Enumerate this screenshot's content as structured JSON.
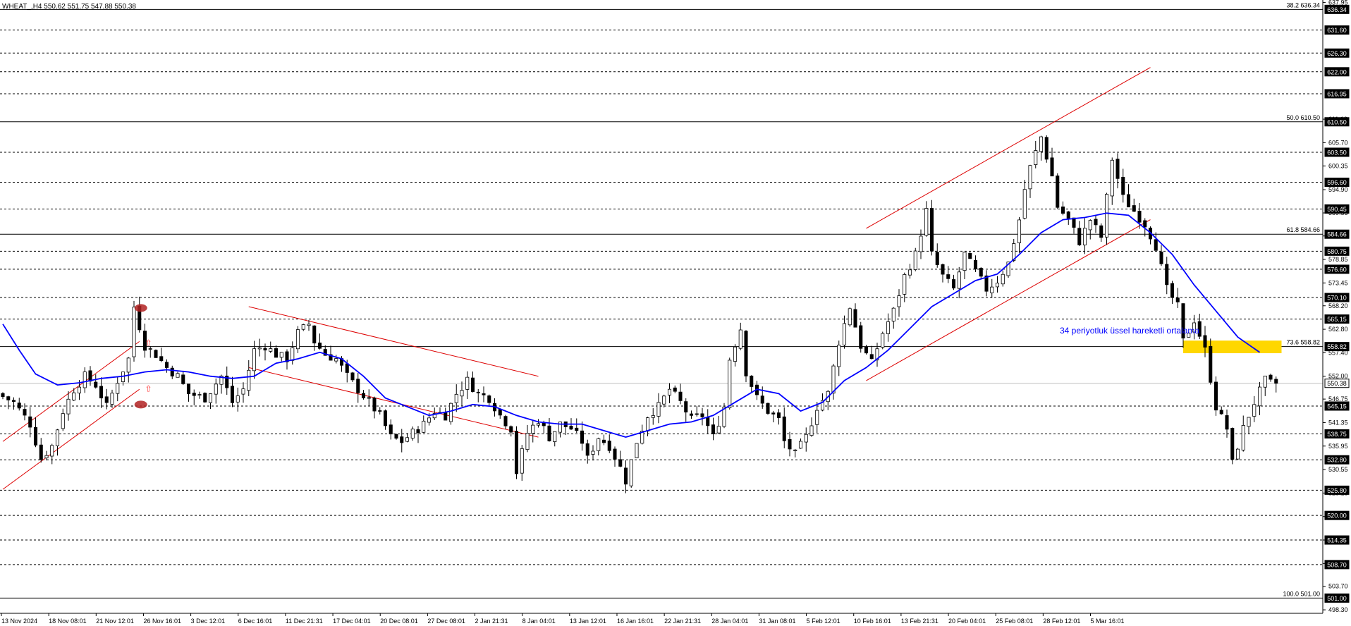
{
  "header": {
    "text": "WHEAT_,H4  550.62 551.75 547.88 550.38"
  },
  "chart_data": {
    "type": "candlestick",
    "symbol": "WHEAT_",
    "timeframe": "H4",
    "ohlc_header": {
      "open": 550.62,
      "high": 551.75,
      "low": 547.88,
      "close": 550.38
    },
    "current_price": 550.38,
    "y_range": [
      497.5,
      638.5
    ],
    "y_ticks": [
      "637.95",
      "611.10",
      "605.70",
      "600.35",
      "594.90",
      "589.55",
      "584.25",
      "578.85",
      "573.45",
      "568.20",
      "562.80",
      "557.40",
      "552.00",
      "546.75",
      "541.35",
      "535.95",
      "530.55",
      "525.15",
      "519.75",
      "514.35",
      "508.95",
      "503.70",
      "498.30"
    ],
    "price_tags": [
      "636.34",
      "631.60",
      "626.30",
      "622.00",
      "616.95",
      "610.50",
      "603.50",
      "596.60",
      "590.45",
      "584.66",
      "580.75",
      "576.60",
      "570.10",
      "565.15",
      "558.82",
      "550.38",
      "545.15",
      "538.75",
      "532.80",
      "525.80",
      "520.00",
      "514.35",
      "508.70",
      "501.00"
    ],
    "x_labels": [
      "13 Nov 2024",
      "18 Nov 08:01",
      "21 Nov 12:01",
      "26 Nov 16:01",
      "3 Dec 12:01",
      "6 Dec 16:01",
      "11 Dec 21:31",
      "17 Dec 04:01",
      "20 Dec 08:01",
      "27 Dec 08:01",
      "2 Jan 21:31",
      "8 Jan 04:01",
      "13 Jan 12:01",
      "16 Jan 16:01",
      "22 Jan 21:31",
      "28 Jan 04:01",
      "31 Jan 08:01",
      "5 Feb 12:01",
      "10 Feb 16:01",
      "13 Feb 21:31",
      "20 Feb 04:01",
      "25 Feb 08:01",
      "28 Feb 12:01",
      "5 Mar 16:01"
    ],
    "fib_levels": [
      {
        "label": "38.2 636.34",
        "value": 636.34
      },
      {
        "label": "50.0 610.50",
        "value": 610.5
      },
      {
        "label": "61.8 584.66",
        "value": 584.66
      },
      {
        "label": "73.6 558.82",
        "value": 558.82
      },
      {
        "label": "100.0 501.00",
        "value": 501.0
      }
    ],
    "horizontal_levels": [
      631.6,
      626.3,
      622.0,
      616.95,
      603.5,
      596.6,
      590.45,
      580.75,
      576.6,
      570.1,
      565.15,
      545.15,
      538.75,
      532.8,
      525.8,
      520.0,
      514.35,
      508.7
    ],
    "price_path": [
      [
        0,
        548
      ],
      [
        3,
        546
      ],
      [
        6,
        541
      ],
      [
        8,
        533
      ],
      [
        10,
        536
      ],
      [
        12,
        544
      ],
      [
        14,
        549
      ],
      [
        16,
        552
      ],
      [
        18,
        550
      ],
      [
        20,
        545
      ],
      [
        22,
        551
      ],
      [
        24,
        556
      ],
      [
        25,
        568
      ],
      [
        27,
        559
      ],
      [
        29,
        557
      ],
      [
        31,
        554
      ],
      [
        33,
        552
      ],
      [
        35,
        548
      ],
      [
        38,
        547
      ],
      [
        41,
        552
      ],
      [
        43,
        546
      ],
      [
        45,
        549
      ],
      [
        47,
        558
      ],
      [
        49,
        559
      ],
      [
        51,
        557
      ],
      [
        53,
        556
      ],
      [
        55,
        562
      ],
      [
        57,
        564
      ],
      [
        58,
        560
      ],
      [
        60,
        557
      ],
      [
        62,
        556
      ],
      [
        64,
        552
      ],
      [
        66,
        549
      ],
      [
        68,
        546
      ],
      [
        70,
        543
      ],
      [
        72,
        538
      ],
      [
        74,
        537
      ],
      [
        76,
        539
      ],
      [
        78,
        541
      ],
      [
        80,
        544
      ],
      [
        82,
        543
      ],
      [
        84,
        548
      ],
      [
        86,
        551
      ],
      [
        88,
        548
      ],
      [
        90,
        547
      ],
      [
        92,
        543
      ],
      [
        94,
        540
      ],
      [
        95,
        530
      ],
      [
        97,
        539
      ],
      [
        99,
        542
      ],
      [
        101,
        538
      ],
      [
        103,
        541
      ],
      [
        105,
        540
      ],
      [
        107,
        537
      ],
      [
        108,
        533
      ],
      [
        110,
        538
      ],
      [
        112,
        536
      ],
      [
        114,
        531
      ],
      [
        115,
        528
      ],
      [
        117,
        537
      ],
      [
        119,
        543
      ],
      [
        121,
        545
      ],
      [
        123,
        549
      ],
      [
        125,
        546
      ],
      [
        127,
        542
      ],
      [
        129,
        543
      ],
      [
        131,
        538
      ],
      [
        133,
        545
      ],
      [
        134,
        556
      ],
      [
        136,
        563
      ],
      [
        137,
        553
      ],
      [
        139,
        547
      ],
      [
        141,
        544
      ],
      [
        143,
        542
      ],
      [
        144,
        537
      ],
      [
        146,
        534
      ],
      [
        148,
        538
      ],
      [
        150,
        545
      ],
      [
        152,
        548
      ],
      [
        154,
        560
      ],
      [
        156,
        568
      ],
      [
        158,
        559
      ],
      [
        160,
        555
      ],
      [
        162,
        562
      ],
      [
        164,
        567
      ],
      [
        166,
        575
      ],
      [
        168,
        580
      ],
      [
        169,
        585
      ],
      [
        170,
        590
      ],
      [
        171,
        580
      ],
      [
        173,
        575
      ],
      [
        175,
        572
      ],
      [
        177,
        580
      ],
      [
        179,
        576
      ],
      [
        181,
        572
      ],
      [
        183,
        574
      ],
      [
        185,
        578
      ],
      [
        187,
        588
      ],
      [
        188,
        595
      ],
      [
        189,
        600
      ],
      [
        191,
        607
      ],
      [
        193,
        598
      ],
      [
        194,
        591
      ],
      [
        196,
        588
      ],
      [
        198,
        583
      ],
      [
        200,
        588
      ],
      [
        202,
        584
      ],
      [
        204,
        602
      ],
      [
        206,
        593
      ],
      [
        208,
        590
      ],
      [
        210,
        587
      ],
      [
        212,
        582
      ],
      [
        214,
        572
      ],
      [
        216,
        568
      ],
      [
        217,
        560
      ],
      [
        219,
        565
      ],
      [
        221,
        558
      ],
      [
        223,
        545
      ],
      [
        225,
        540
      ],
      [
        226,
        532
      ],
      [
        228,
        540
      ],
      [
        230,
        546
      ],
      [
        232,
        551
      ],
      [
        233,
        550.4
      ]
    ],
    "ema": {
      "label": "34 periyotluk üssel hareketli ortalama",
      "period": 34,
      "color": "#0000ff",
      "points": [
        [
          0,
          564
        ],
        [
          3,
          558
        ],
        [
          6,
          552.5
        ],
        [
          10,
          550
        ],
        [
          14,
          550.5
        ],
        [
          18,
          551.5
        ],
        [
          22,
          552
        ],
        [
          26,
          553
        ],
        [
          30,
          553.5
        ],
        [
          34,
          553
        ],
        [
          38,
          552
        ],
        [
          42,
          551.5
        ],
        [
          46,
          552
        ],
        [
          50,
          555
        ],
        [
          54,
          556
        ],
        [
          58,
          557.5
        ],
        [
          62,
          556
        ],
        [
          66,
          552
        ],
        [
          70,
          547
        ],
        [
          74,
          545
        ],
        [
          78,
          543
        ],
        [
          82,
          544
        ],
        [
          86,
          545.5
        ],
        [
          90,
          545
        ],
        [
          94,
          543
        ],
        [
          98,
          541.5
        ],
        [
          102,
          541
        ],
        [
          106,
          541
        ],
        [
          110,
          539.5
        ],
        [
          114,
          538
        ],
        [
          118,
          539.5
        ],
        [
          122,
          541
        ],
        [
          126,
          541.5
        ],
        [
          130,
          543
        ],
        [
          134,
          546
        ],
        [
          138,
          549
        ],
        [
          142,
          548
        ],
        [
          146,
          544
        ],
        [
          150,
          546
        ],
        [
          154,
          551
        ],
        [
          158,
          554
        ],
        [
          162,
          558
        ],
        [
          166,
          563
        ],
        [
          170,
          568
        ],
        [
          174,
          571
        ],
        [
          178,
          574
        ],
        [
          182,
          575.5
        ],
        [
          186,
          580
        ],
        [
          190,
          585
        ],
        [
          194,
          588
        ],
        [
          198,
          588.5
        ],
        [
          202,
          589.5
        ],
        [
          206,
          589
        ],
        [
          210,
          585
        ],
        [
          214,
          580
        ],
        [
          218,
          573
        ],
        [
          222,
          567
        ],
        [
          226,
          561
        ],
        [
          230,
          557.5
        ]
      ]
    },
    "annotations": [
      {
        "type": "text",
        "text": "34 periyotluk üssel hareketli ortalama",
        "color": "#0000ff"
      },
      {
        "type": "zone",
        "color": "#ffd700",
        "from": 557.3,
        "to": 560.2
      }
    ],
    "channels": [
      {
        "color": "#dd0000",
        "x1": 0,
        "y1": 537,
        "x2": 25,
        "y2": 560,
        "parallel_offset": -11
      },
      {
        "color": "#dd0000",
        "x1": 45,
        "y1": 568,
        "x2": 98,
        "y2": 552,
        "parallel_offset": -14
      },
      {
        "color": "#dd0000",
        "x1": 158,
        "y1": 586,
        "x2": 210,
        "y2": 623,
        "parallel_offset": -35
      }
    ],
    "colors": {
      "background": "#ffffff",
      "candle": "#000000",
      "grid": "#000000",
      "fib_line": "#000000",
      "channel": "#dd0000",
      "ema": "#0000ff",
      "zone": "#ffd700",
      "marker": "#b22222"
    }
  }
}
